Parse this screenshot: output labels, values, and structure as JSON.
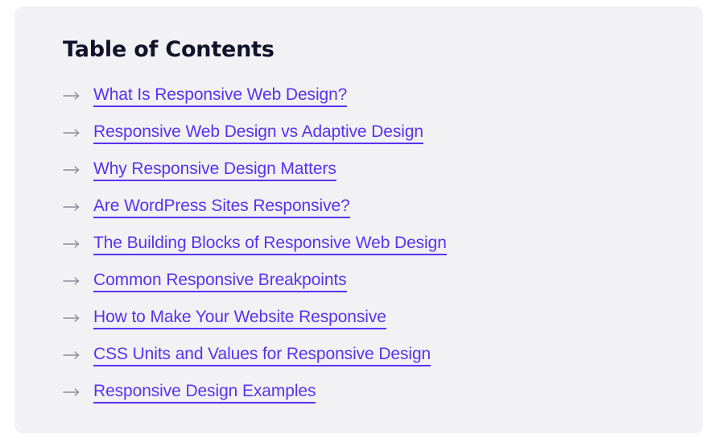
{
  "card": {
    "background_color": "#f2f2f4",
    "page_background_color": "#ffffff"
  },
  "toc": {
    "title": "Table of Contents",
    "title_color": "#12122a",
    "link_color": "#5733ef",
    "marker_color": "#8d8d95",
    "marker_icon": "arrow-right-icon",
    "items": [
      {
        "label": "What Is Responsive Web Design?"
      },
      {
        "label": "Responsive Web Design vs Adaptive Design"
      },
      {
        "label": "Why Responsive Design Matters"
      },
      {
        "label": "Are WordPress Sites Responsive?"
      },
      {
        "label": "The Building Blocks of Responsive Web Design"
      },
      {
        "label": "Common Responsive Breakpoints"
      },
      {
        "label": "How to Make Your Website Responsive"
      },
      {
        "label": "CSS Units and Values for Responsive Design"
      },
      {
        "label": "Responsive Design Examples"
      }
    ]
  }
}
